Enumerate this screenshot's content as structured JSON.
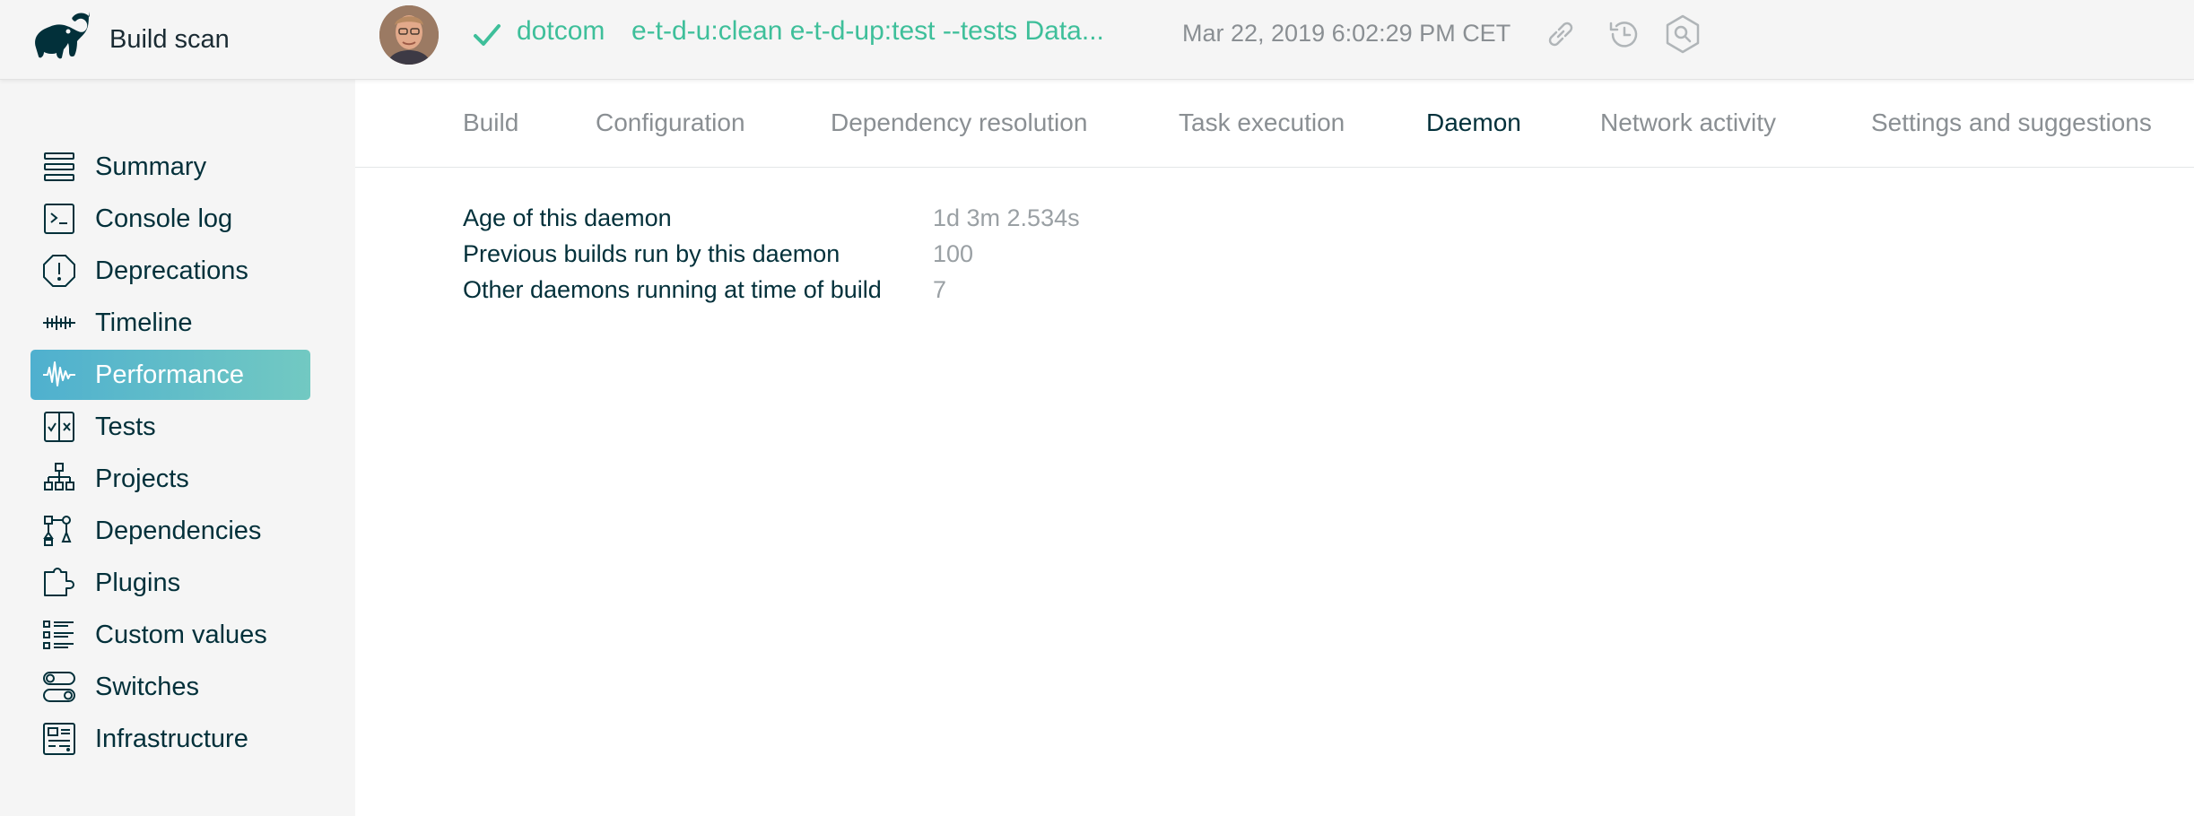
{
  "brand": {
    "title": "Build scan",
    "logo_icon": "gradle-elephant-icon"
  },
  "header": {
    "status_icon": "check-icon",
    "project": "dotcom",
    "tasks": "e-t-d-u:clean e-t-d-up:test --tests Data...",
    "timestamp": "Mar 22, 2019 6:02:29 PM CET",
    "accent_color": "#3ebf9a"
  },
  "sidebar": {
    "items": [
      {
        "label": "Summary",
        "icon": "summary-icon"
      },
      {
        "label": "Console log",
        "icon": "console-icon"
      },
      {
        "label": "Deprecations",
        "icon": "deprecations-icon"
      },
      {
        "label": "Timeline",
        "icon": "timeline-icon"
      },
      {
        "label": "Performance",
        "icon": "performance-icon",
        "active": true
      },
      {
        "label": "Tests",
        "icon": "tests-icon"
      },
      {
        "label": "Projects",
        "icon": "projects-icon"
      },
      {
        "label": "Dependencies",
        "icon": "dependencies-icon"
      },
      {
        "label": "Plugins",
        "icon": "plugins-icon"
      },
      {
        "label": "Custom values",
        "icon": "custom-values-icon"
      },
      {
        "label": "Switches",
        "icon": "switches-icon"
      },
      {
        "label": "Infrastructure",
        "icon": "infrastructure-icon"
      }
    ],
    "active_gradient": [
      "#4fb0cf",
      "#72c9c2"
    ]
  },
  "tabs": [
    {
      "label": "Build"
    },
    {
      "label": "Configuration"
    },
    {
      "label": "Dependency resolution"
    },
    {
      "label": "Task execution"
    },
    {
      "label": "Daemon",
      "active": true
    },
    {
      "label": "Network activity"
    },
    {
      "label": "Settings and suggestions"
    }
  ],
  "daemon": {
    "rows": [
      {
        "label": "Age of this daemon",
        "value": "1d 3m 2.534s"
      },
      {
        "label": "Previous builds run by this daemon",
        "value": "100"
      },
      {
        "label": "Other daemons running at time of build",
        "value": "7"
      }
    ]
  }
}
